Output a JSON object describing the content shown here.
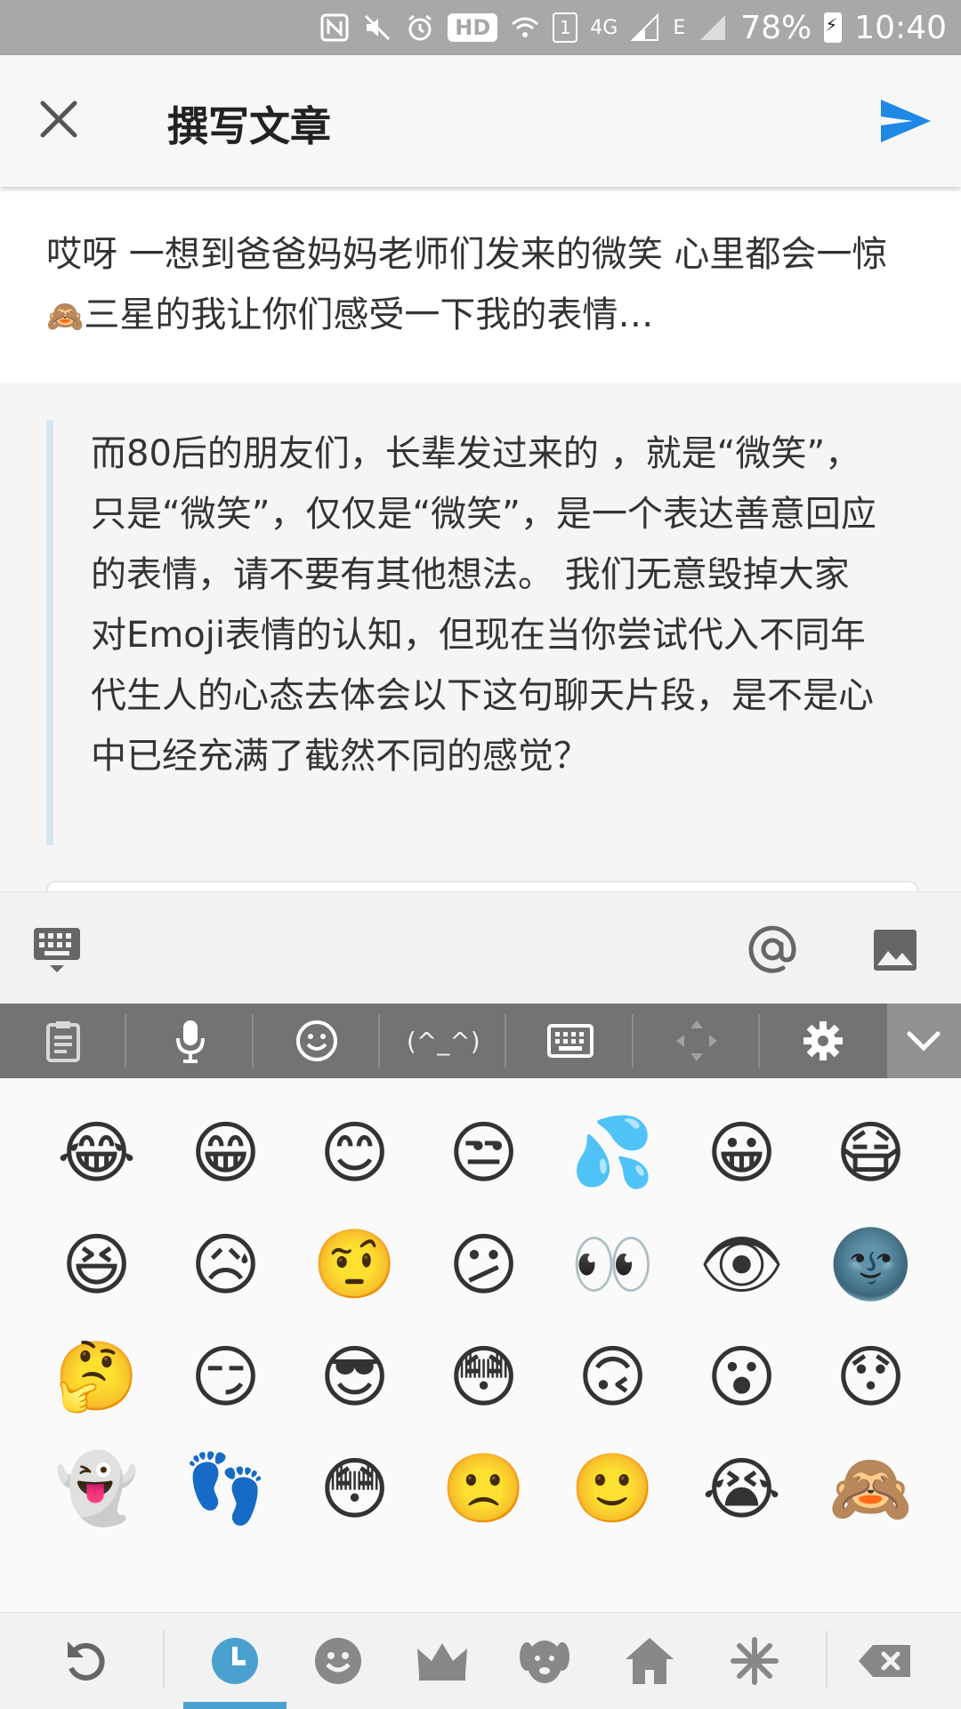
{
  "status_bar": {
    "network_badge": "HD",
    "sim_slot": "1",
    "network_type": "4G",
    "edge_label": "E",
    "battery": "78%",
    "time": "10:40"
  },
  "header": {
    "title": "撰写文章"
  },
  "article": {
    "intro_part1": "哎呀 一想到爸爸妈妈老师们发来的微笑 心里都会一惊",
    "intro_emoji": "🙈",
    "intro_part2": "三星的我让你们感受一下我的表情…",
    "quote": "而80后的朋友们，长辈发过来的 ，就是“微笑”，只是“微笑”，仅仅是“微笑”，是一个表达善意回应的表情，请不要有其他想法。 我们无意毁掉大家对Emoji表情的认知，但现在当你尝试代入不同年代生人的心态去体会以下这句聊天片段，是不是心中已经充满了截然不同的感觉？"
  },
  "keyboard": {
    "kaomoji_label": "(^_^)",
    "emojis": [
      "😂",
      "😁",
      "😊",
      "😒",
      "💦",
      "😀",
      "😷",
      "😆",
      "😥",
      "🤨",
      "😕",
      "👀",
      "👁",
      "🌚",
      "🤔",
      "😏",
      "😎",
      "😳",
      "🙃",
      "😮",
      "😯",
      "👻",
      "👣",
      "😳",
      "🙁",
      "🙂",
      "😭",
      "🙈"
    ]
  },
  "colors": {
    "accent": "#1e88e5",
    "quote_bar": "#d5e6f3",
    "active_tab": "#4aa1d0"
  }
}
